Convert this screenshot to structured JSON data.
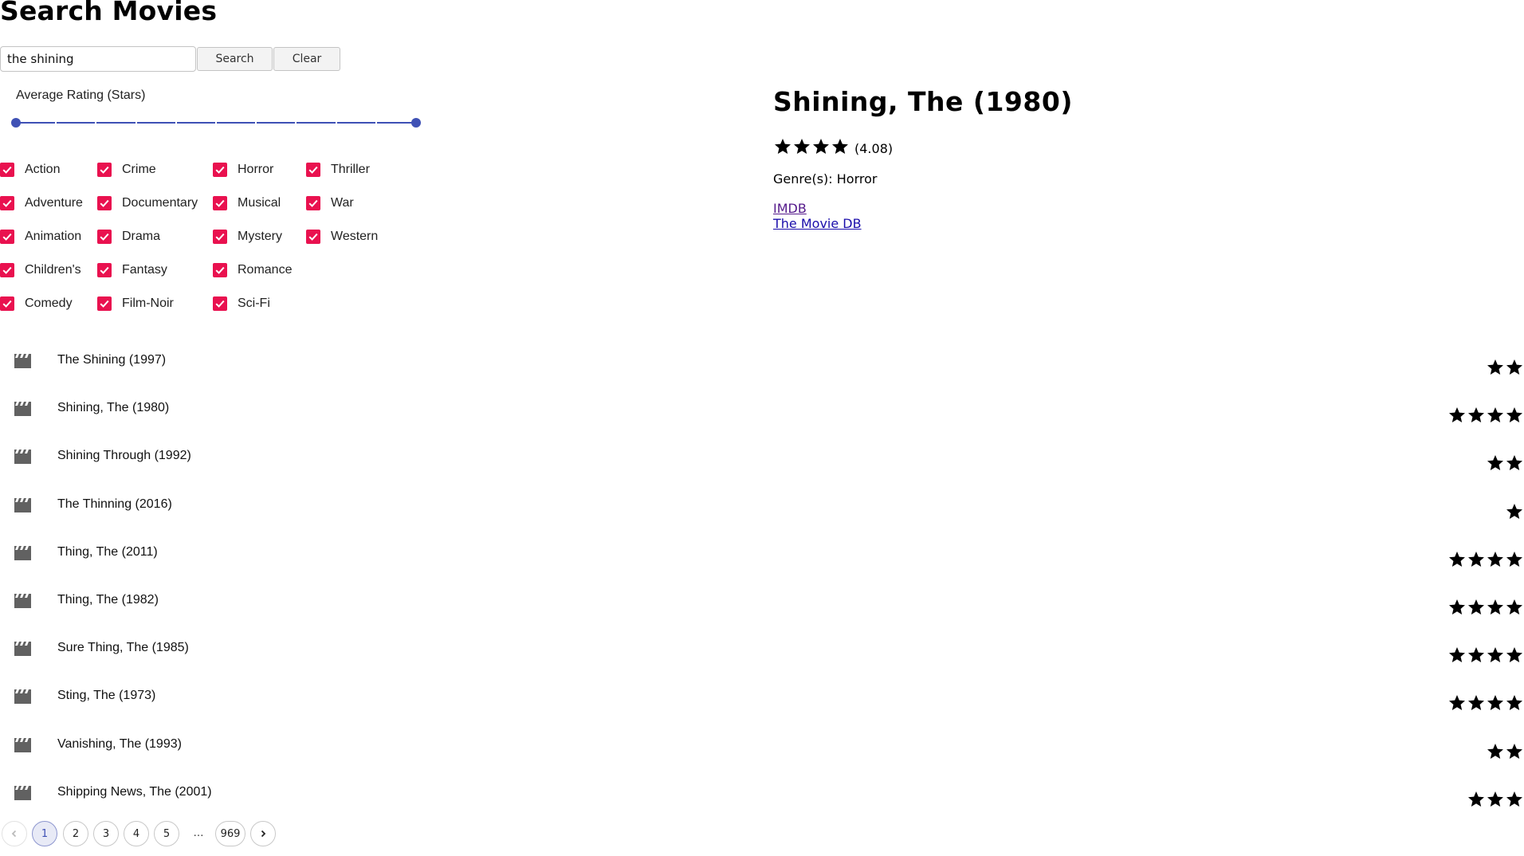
{
  "page": {
    "title": "Search Movies"
  },
  "search": {
    "value": "the shining",
    "search_label": "Search",
    "clear_label": "Clear"
  },
  "rating_filter": {
    "label": "Average Rating (Stars)",
    "min": 0,
    "max": 5,
    "step": 0.5,
    "low": 0,
    "high": 5,
    "accent": "#3f51b5"
  },
  "genres": {
    "checkbox_color": "#e9114f",
    "columns": [
      [
        {
          "label": "Action",
          "checked": true
        },
        {
          "label": "Adventure",
          "checked": true
        },
        {
          "label": "Animation",
          "checked": true
        },
        {
          "label": "Children's",
          "checked": true
        },
        {
          "label": "Comedy",
          "checked": true
        }
      ],
      [
        {
          "label": "Crime",
          "checked": true
        },
        {
          "label": "Documentary",
          "checked": true
        },
        {
          "label": "Drama",
          "checked": true
        },
        {
          "label": "Fantasy",
          "checked": true
        },
        {
          "label": "Film-Noir",
          "checked": true
        }
      ],
      [
        {
          "label": "Horror",
          "checked": true
        },
        {
          "label": "Musical",
          "checked": true
        },
        {
          "label": "Mystery",
          "checked": true
        },
        {
          "label": "Romance",
          "checked": true
        },
        {
          "label": "Sci-Fi",
          "checked": true
        }
      ],
      [
        {
          "label": "Thriller",
          "checked": true
        },
        {
          "label": "War",
          "checked": true
        },
        {
          "label": "Western",
          "checked": true
        }
      ]
    ]
  },
  "results": [
    {
      "title": "The Shining (1997)",
      "stars": 2,
      "icon": "clapperboard-icon"
    },
    {
      "title": "Shining, The (1980)",
      "stars": 4,
      "icon": "clapperboard-icon"
    },
    {
      "title": "Shining Through (1992)",
      "stars": 2,
      "icon": "clapperboard-icon"
    },
    {
      "title": "The Thinning (2016)",
      "stars": 1,
      "icon": "clapperboard-icon"
    },
    {
      "title": "Thing, The (2011)",
      "stars": 4,
      "icon": "clapperboard-icon"
    },
    {
      "title": "Thing, The (1982)",
      "stars": 4,
      "icon": "clapperboard-icon"
    },
    {
      "title": "Sure Thing, The (1985)",
      "stars": 4,
      "icon": "clapperboard-icon"
    },
    {
      "title": "Sting, The (1973)",
      "stars": 4,
      "icon": "clapperboard-icon"
    },
    {
      "title": "Vanishing, The (1993)",
      "stars": 2,
      "icon": "clapperboard-icon"
    },
    {
      "title": "Shipping News, The (2001)",
      "stars": 3,
      "icon": "clapperboard-icon"
    }
  ],
  "pagination": {
    "current": 1,
    "pages": [
      "1",
      "2",
      "3",
      "4",
      "5"
    ],
    "ellipsis": "…",
    "last": "969",
    "prev_icon": "chevron-left-icon",
    "next_icon": "chevron-right-icon"
  },
  "detail": {
    "title": "Shining, The (1980)",
    "stars": 4,
    "score": "(4.08)",
    "genres_text": "Genre(s): Horror",
    "links": [
      {
        "label": "IMDB",
        "visited": true
      },
      {
        "label": "The Movie DB",
        "visited": false
      }
    ]
  }
}
